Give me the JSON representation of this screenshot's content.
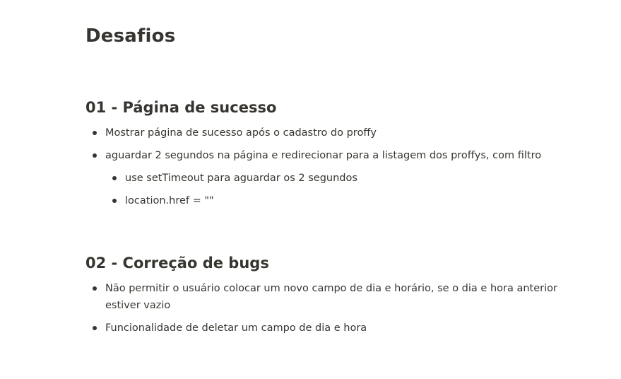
{
  "page": {
    "title": "Desafios"
  },
  "sections": [
    {
      "heading": "01 - Página de sucesso",
      "items": [
        "Mostrar página de sucesso após o cadastro do proffy",
        "aguardar 2 segundos na página e redirecionar para a listagem dos proffys, com filtro"
      ],
      "subitems": [
        "use setTimeout para aguardar os 2 segundos",
        "location.href = \"\""
      ]
    },
    {
      "heading": "02 - Correção de bugs",
      "items": [
        "Não permitir o usuário colocar um novo campo de dia e horário, se o dia e hora anterior estiver vazio",
        "Funcionalidade de deletar um campo de dia e hora"
      ]
    }
  ]
}
